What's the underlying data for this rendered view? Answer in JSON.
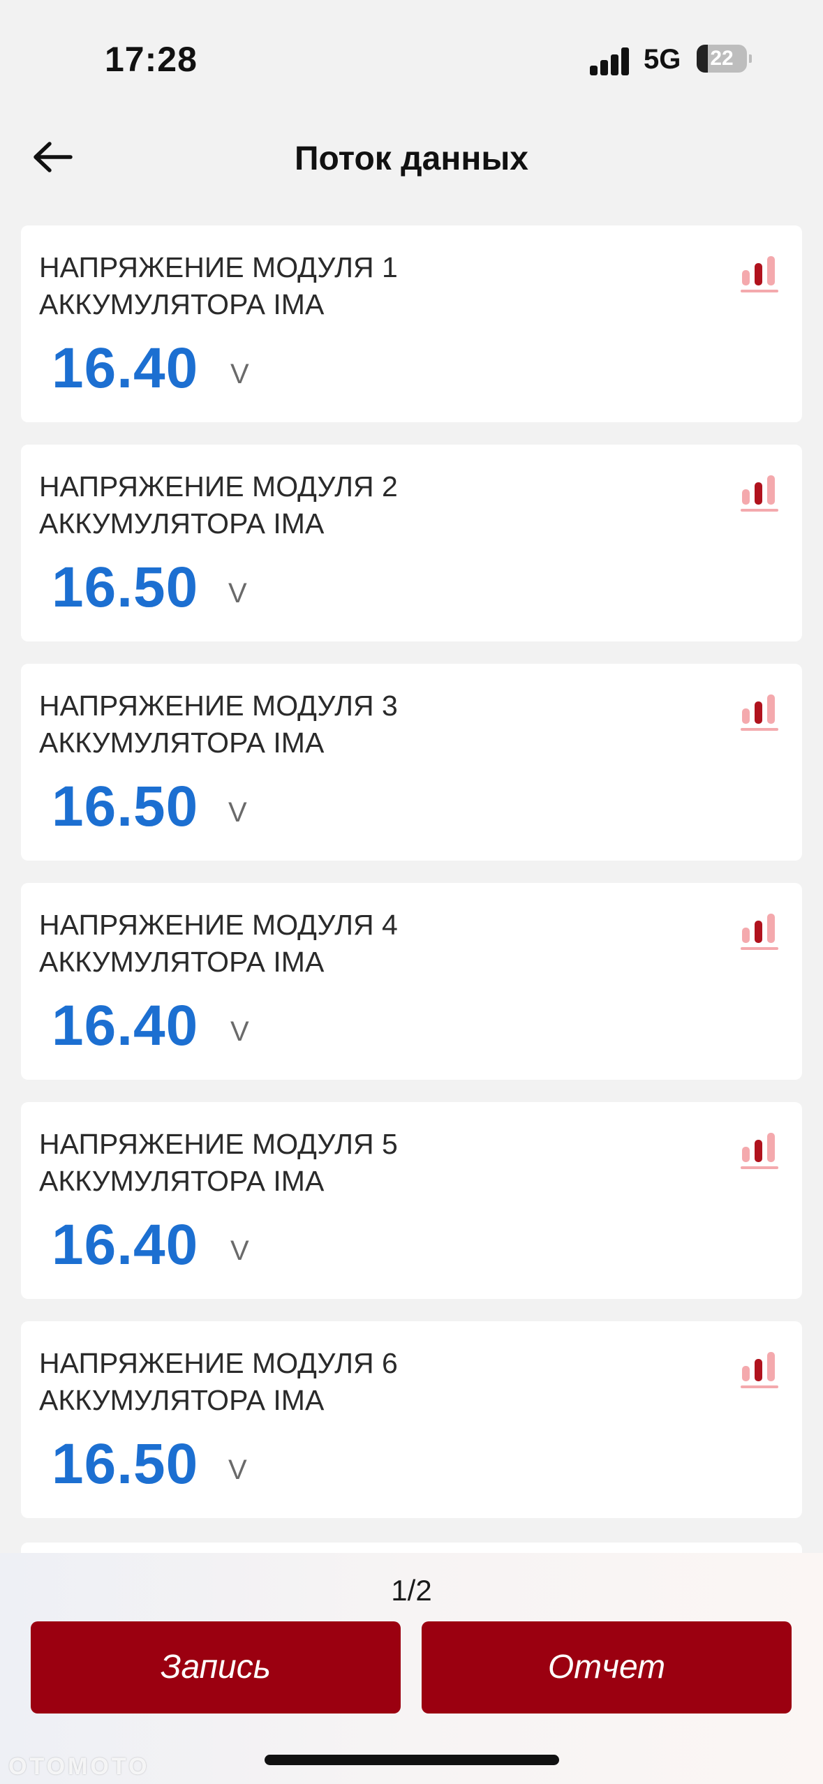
{
  "status_bar": {
    "time": "17:28",
    "network": "5G",
    "battery_level": "22",
    "battery_fraction": 0.22
  },
  "header": {
    "back_icon": "arrow-left-icon",
    "title": "Поток данных"
  },
  "cards": [
    {
      "label_line1": "НАПРЯЖЕНИЕ МОДУЛЯ 1",
      "label_line2": "АККУМУЛЯТОРА IMA",
      "value": "16.40",
      "unit": "V",
      "icon": "bar-chart-icon"
    },
    {
      "label_line1": "НАПРЯЖЕНИЕ МОДУЛЯ 2",
      "label_line2": "АККУМУЛЯТОРА IMA",
      "value": "16.50",
      "unit": "V",
      "icon": "bar-chart-icon"
    },
    {
      "label_line1": "НАПРЯЖЕНИЕ МОДУЛЯ 3",
      "label_line2": "АККУМУЛЯТОРА IMA",
      "value": "16.50",
      "unit": "V",
      "icon": "bar-chart-icon"
    },
    {
      "label_line1": "НАПРЯЖЕНИЕ МОДУЛЯ 4",
      "label_line2": "АККУМУЛЯТОРА IMA",
      "value": "16.40",
      "unit": "V",
      "icon": "bar-chart-icon"
    },
    {
      "label_line1": "НАПРЯЖЕНИЕ МОДУЛЯ 5",
      "label_line2": "АККУМУЛЯТОРА IMA",
      "value": "16.40",
      "unit": "V",
      "icon": "bar-chart-icon"
    },
    {
      "label_line1": "НАПРЯЖЕНИЕ МОДУЛЯ 6",
      "label_line2": "АККУМУЛЯТОРА IMA",
      "value": "16.50",
      "unit": "V",
      "icon": "bar-chart-icon"
    }
  ],
  "pagination": {
    "label": "1/2"
  },
  "actions": {
    "record_label": "Запись",
    "report_label": "Отчет"
  },
  "colors": {
    "value_blue": "#1c6fd1",
    "button_red": "#9b0010",
    "chart_icon_dark": "#b0121d",
    "chart_icon_light": "#f4a9ad"
  },
  "watermark": "OTOMOTO"
}
